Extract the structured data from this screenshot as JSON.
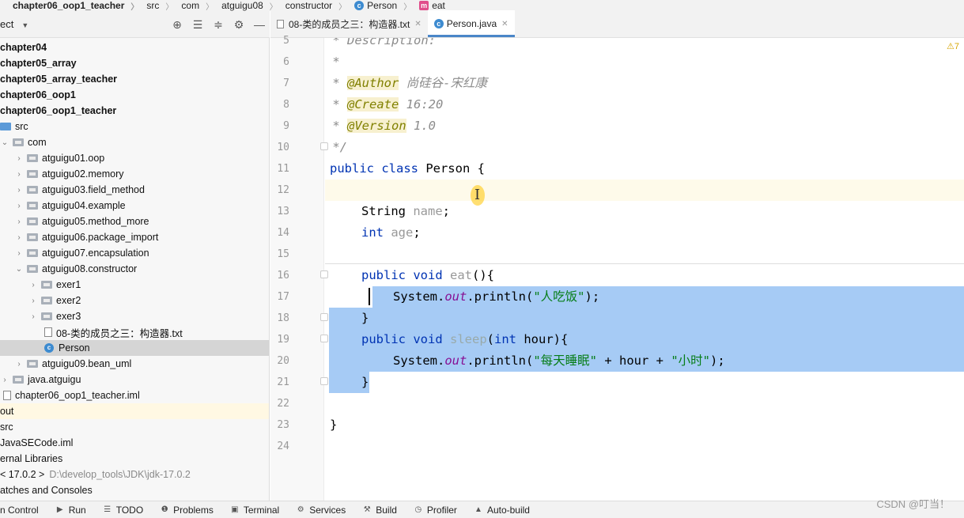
{
  "breadcrumb": {
    "items": [
      "chapter06_oop1_teacher",
      "src",
      "com",
      "atguigu08",
      "constructor",
      "Person",
      "eat"
    ]
  },
  "project_panel": {
    "title": "ect",
    "tree": [
      {
        "label": "chapter04",
        "bold": true
      },
      {
        "label": "chapter05_array",
        "bold": true
      },
      {
        "label": "chapter05_array_teacher",
        "bold": true
      },
      {
        "label": "chapter06_oop1",
        "bold": true
      },
      {
        "label": "chapter06_oop1_teacher",
        "bold": true
      },
      {
        "label": "src"
      },
      {
        "label": "com"
      },
      {
        "label": "atguigu01.oop"
      },
      {
        "label": "atguigu02.memory"
      },
      {
        "label": "atguigu03.field_method"
      },
      {
        "label": "atguigu04.example"
      },
      {
        "label": "atguigu05.method_more"
      },
      {
        "label": "atguigu06.package_import"
      },
      {
        "label": "atguigu07.encapsulation"
      },
      {
        "label": "atguigu08.constructor"
      },
      {
        "label": "exer1"
      },
      {
        "label": "exer2"
      },
      {
        "label": "exer3"
      },
      {
        "label": "08-类的成员之三：构造器.txt"
      },
      {
        "label": "Person",
        "selected": true
      },
      {
        "label": "atguigu09.bean_uml"
      },
      {
        "label": "java.atguigu"
      },
      {
        "label": "chapter06_oop1_teacher.iml"
      },
      {
        "label": "out"
      },
      {
        "label": "src"
      },
      {
        "label": "JavaSECode.iml"
      },
      {
        "label": "ernal Libraries"
      },
      {
        "label": "< 17.0.2 >",
        "path": "D:\\develop_tools\\JDK\\jdk-17.0.2"
      },
      {
        "label": "atches and Consoles"
      }
    ]
  },
  "editor": {
    "tabs": [
      {
        "label": "08-类的成员之三：构造器.txt",
        "active": false
      },
      {
        "label": "Person.java",
        "active": true
      }
    ],
    "line_numbers": [
      "5",
      "6",
      "7",
      "8",
      "9",
      "10",
      "11",
      "12",
      "13",
      "14",
      "15",
      "16",
      "17",
      "18",
      "19",
      "20",
      "21",
      "22",
      "23",
      "24"
    ],
    "code": {
      "l5": " * Description:",
      "l6": " *",
      "l7_star": " * ",
      "l7_tag": "@Author",
      "l7_val": " 尚硅谷-宋红康",
      "l8_tag": "@Create",
      "l8_val": " 16:20",
      "l9_tag": "@Version",
      "l9_val": " 1.0",
      "l10": " */",
      "l11_kw": "public class",
      "l11_rest": " Person {",
      "l13_type": "String",
      "l13_field": "name",
      "l14_kw": "int",
      "l14_field": "age",
      "l16_kw": "public void",
      "l16_name": "eat",
      "l16_rest": "(){",
      "l17_a": "System.",
      "l17_out": "out",
      "l17_b": ".println(",
      "l17_str": "\"人吃饭\"",
      "l17_c": ");",
      "l18": "}",
      "l19_kw": "public void",
      "l19_name": "sleep",
      "l19_rest_a": "(",
      "l19_kw2": "int",
      "l19_rest_b": " hour){",
      "l20_a": "System.",
      "l20_out": "out",
      "l20_b": ".println(",
      "l20_str1": "\"每天睡眠\"",
      "l20_mid": " + hour + ",
      "l20_str2": "\"小时\"",
      "l20_c": ");",
      "l21": "}",
      "l23": "}"
    },
    "warning_badge": "⚠7"
  },
  "bottom_bar": {
    "items": [
      {
        "icon": "",
        "label": "n Control"
      },
      {
        "icon": "▶",
        "label": "Run"
      },
      {
        "icon": "☰",
        "label": "TODO"
      },
      {
        "icon": "❶",
        "label": "Problems"
      },
      {
        "icon": "▣",
        "label": "Terminal"
      },
      {
        "icon": "⚙",
        "label": "Services"
      },
      {
        "icon": "⚒",
        "label": "Build"
      },
      {
        "icon": "◷",
        "label": "Profiler"
      },
      {
        "icon": "▲",
        "label": "Auto-build"
      }
    ],
    "watermark": "CSDN @叮当！"
  }
}
